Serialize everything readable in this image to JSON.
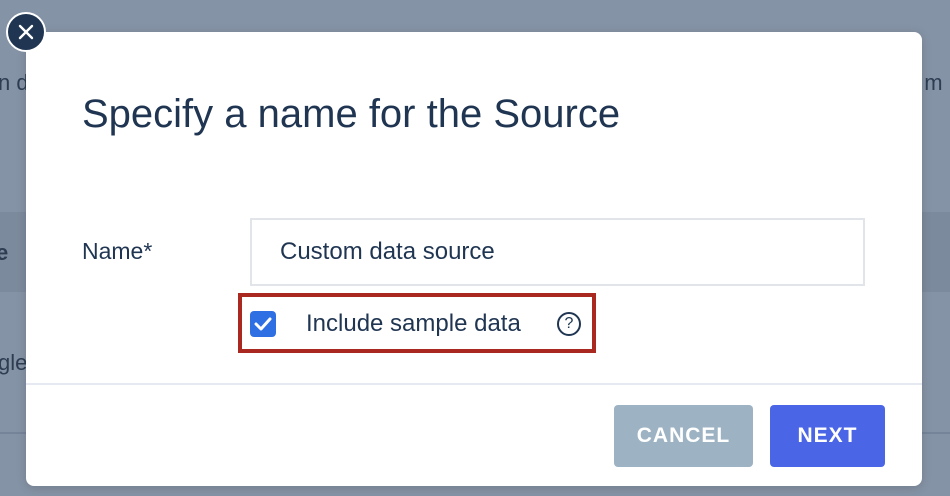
{
  "background": {
    "fragment_1": "n d",
    "fragment_2": "e",
    "fragment_3": "gle",
    "fragment_4": "t m"
  },
  "dialog": {
    "title": "Specify a name for the Source",
    "close_icon": "close-icon",
    "name_label": "Name*",
    "name_value": "Custom data source",
    "checkbox_label": "Include sample data",
    "checkbox_checked": true,
    "help_icon": "?",
    "cancel_label": "CANCEL",
    "next_label": "NEXT"
  },
  "colors": {
    "primary": "#4a65e6",
    "cancel_disabled": "#9db3c4",
    "checkbox": "#2f6fe4",
    "highlight_border": "#a9281f",
    "text": "#1f3551"
  }
}
